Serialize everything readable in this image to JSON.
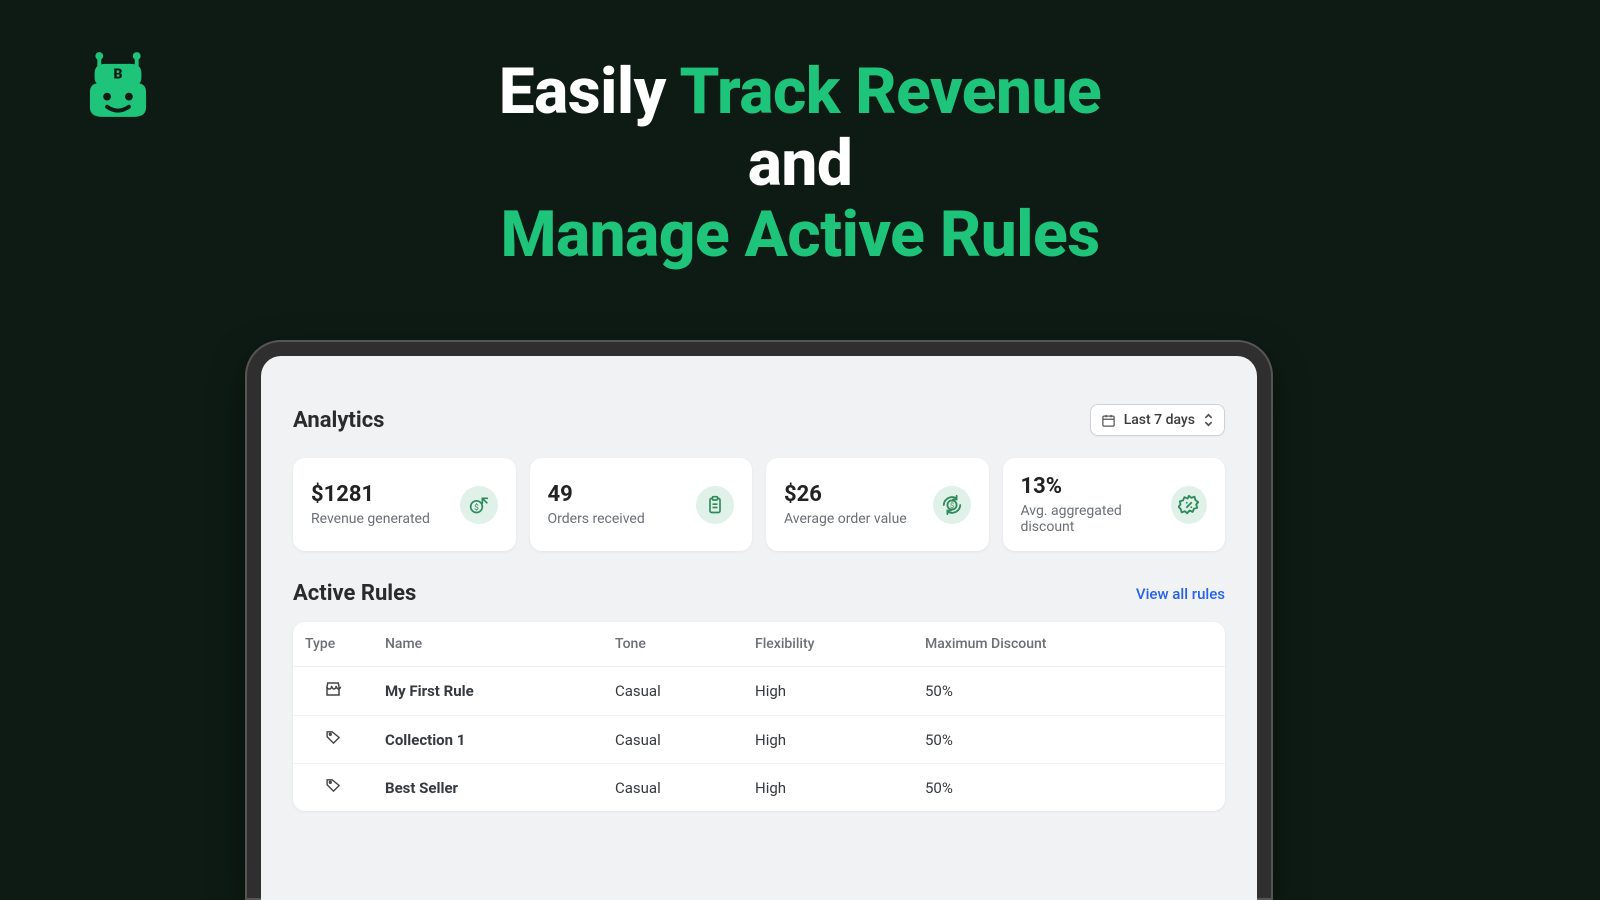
{
  "brand": {
    "logo_letter": "B"
  },
  "hero": {
    "line1_white": "Easily ",
    "line1_green": "Track Revenue",
    "line2_white": "and",
    "line3_green": "Manage Active Rules"
  },
  "analytics": {
    "title": "Analytics",
    "date_range": "Last 7 days",
    "metrics": [
      {
        "value": "$1281",
        "label": "Revenue generated",
        "icon": "dollar-up-icon"
      },
      {
        "value": "49",
        "label": "Orders received",
        "icon": "clipboard-icon"
      },
      {
        "value": "$26",
        "label": "Average order value",
        "icon": "dollar-cycle-icon"
      },
      {
        "value": "13%",
        "label": "Avg. aggregated discount",
        "icon": "percent-badge-icon"
      }
    ]
  },
  "rules": {
    "title": "Active Rules",
    "view_all": "View all rules",
    "headers": {
      "type": "Type",
      "name": "Name",
      "tone": "Tone",
      "flexibility": "Flexibility",
      "max_discount": "Maximum Discount"
    },
    "rows": [
      {
        "type_icon": "storefront-icon",
        "name": "My First Rule",
        "tone": "Casual",
        "flexibility": "High",
        "max_discount": "50%"
      },
      {
        "type_icon": "tag-outline-icon",
        "name": "Collection 1",
        "tone": "Casual",
        "flexibility": "High",
        "max_discount": "50%"
      },
      {
        "type_icon": "tag-outline-icon",
        "name": "Best Seller",
        "tone": "Casual",
        "flexibility": "High",
        "max_discount": "50%"
      }
    ]
  },
  "colors": {
    "accent": "#1ec47a",
    "bg": "#0e1b15"
  }
}
